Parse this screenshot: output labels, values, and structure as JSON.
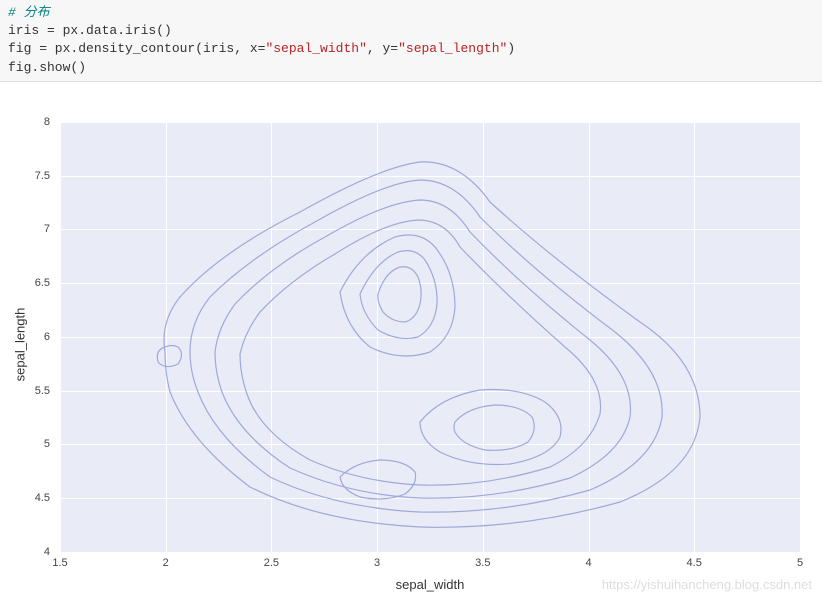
{
  "code": {
    "comment": "# 分布",
    "line1_pre": "iris = px.data.iris()",
    "line2_pre": "fig = px.density_contour(iris, x=",
    "line2_str1": "\"sepal_width\"",
    "line2_mid": ", y=",
    "line2_str2": "\"sepal_length\"",
    "line2_post": ")",
    "line3": "fig.show()"
  },
  "chart_data": {
    "type": "density_contour",
    "xlabel": "sepal_width",
    "ylabel": "sepal_length",
    "xlim": [
      1.5,
      5
    ],
    "ylim": [
      4,
      8
    ],
    "x_ticks": [
      1.5,
      2,
      2.5,
      3,
      3.5,
      4,
      4.5,
      5
    ],
    "y_ticks": [
      4,
      4.5,
      5,
      5.5,
      6,
      6.5,
      7,
      7.5,
      8
    ],
    "density_peaks": [
      {
        "x": 3.1,
        "y": 6.6,
        "intensity": "high"
      },
      {
        "x": 3.5,
        "y": 5.3,
        "intensity": "medium"
      },
      {
        "x": 3.0,
        "y": 4.8,
        "intensity": "medium"
      }
    ],
    "contour_levels": 8,
    "dataset": "iris",
    "note": "density contour of iris sepal dimensions; contours span roughly x:[2.0,4.4], y:[4.2,8.0]"
  },
  "watermark": "https://yishuihancheng.blog.csdn.net"
}
